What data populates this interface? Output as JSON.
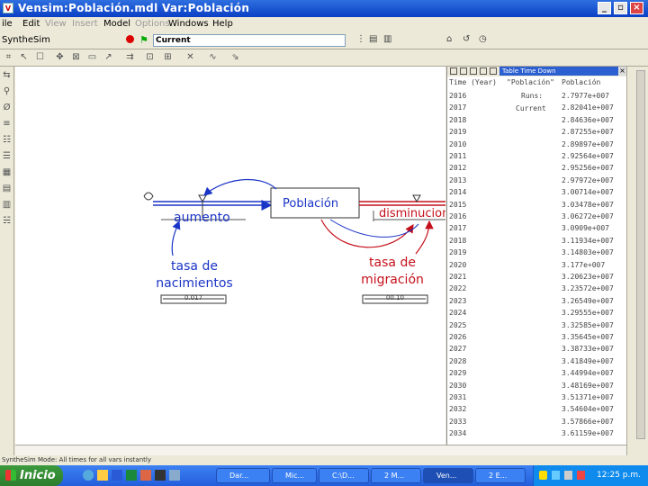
{
  "window": {
    "title": "Vensim:Población.mdl Var:Población"
  },
  "menu": [
    "ile",
    "Edit",
    "View",
    "Insert",
    "Model",
    "Options",
    "Windows",
    "Help"
  ],
  "simbar": {
    "label": "SyntheSim",
    "dataset": "Current"
  },
  "diagram": {
    "stock": "Población",
    "inflow": "aumento",
    "outflow": "disminucion",
    "birth_rate_line1": "tasa de",
    "birth_rate_line2": "nacimientos",
    "birth_value": "0.017",
    "migration_line1": "tasa de",
    "migration_line2": "migración",
    "migration_value": "00.10"
  },
  "table": {
    "title": "Table Time Down",
    "col1": "Time (Year)",
    "col2": "\"Población\"",
    "col3": "Población",
    "runs_label": "Runs:",
    "current_label": "Current",
    "rows": [
      [
        "2016",
        "2.7977e+007"
      ],
      [
        "2017",
        "2.82041e+007"
      ],
      [
        "2018",
        "2.84636e+007"
      ],
      [
        "2019",
        "2.87255e+007"
      ],
      [
        "2010",
        "2.89897e+007"
      ],
      [
        "2011",
        "2.92564e+007"
      ],
      [
        "2012",
        "2.95256e+007"
      ],
      [
        "2013",
        "2.97972e+007"
      ],
      [
        "2014",
        "3.00714e+007"
      ],
      [
        "2015",
        "3.03478e+007"
      ],
      [
        "2016",
        "3.06272e+007"
      ],
      [
        "2017",
        "3.0909e+007"
      ],
      [
        "2018",
        "3.11934e+007"
      ],
      [
        "2019",
        "3.14803e+007"
      ],
      [
        "2020",
        "3.177e+007"
      ],
      [
        "2021",
        "3.20623e+007"
      ],
      [
        "2022",
        "3.23572e+007"
      ],
      [
        "2023",
        "3.26549e+007"
      ],
      [
        "2024",
        "3.29555e+007"
      ],
      [
        "2025",
        "3.32585e+007"
      ],
      [
        "2026",
        "3.35645e+007"
      ],
      [
        "2027",
        "3.38733e+007"
      ],
      [
        "2028",
        "3.41849e+007"
      ],
      [
        "2029",
        "3.44994e+007"
      ],
      [
        "2030",
        "3.48169e+007"
      ],
      [
        "2031",
        "3.51371e+007"
      ],
      [
        "2032",
        "3.54604e+007"
      ],
      [
        "2033",
        "3.57866e+007"
      ],
      [
        "2034",
        "3.61159e+007"
      ]
    ]
  },
  "status": {
    "text": "SyntheSim Mode: All times for all vars instantly"
  },
  "taskbar": {
    "start": "Inicio",
    "items": [
      "Dar...",
      "Mic...",
      "C:\\D...",
      "2 M...",
      "Ven...",
      "2 E..."
    ],
    "clock": "12:25 p.m."
  },
  "colors": {
    "title_blue": "#0a3fc4",
    "flow_blue": "#1a34c6",
    "flow_red": "#c4101a",
    "table_title": "#2c5fd0"
  }
}
